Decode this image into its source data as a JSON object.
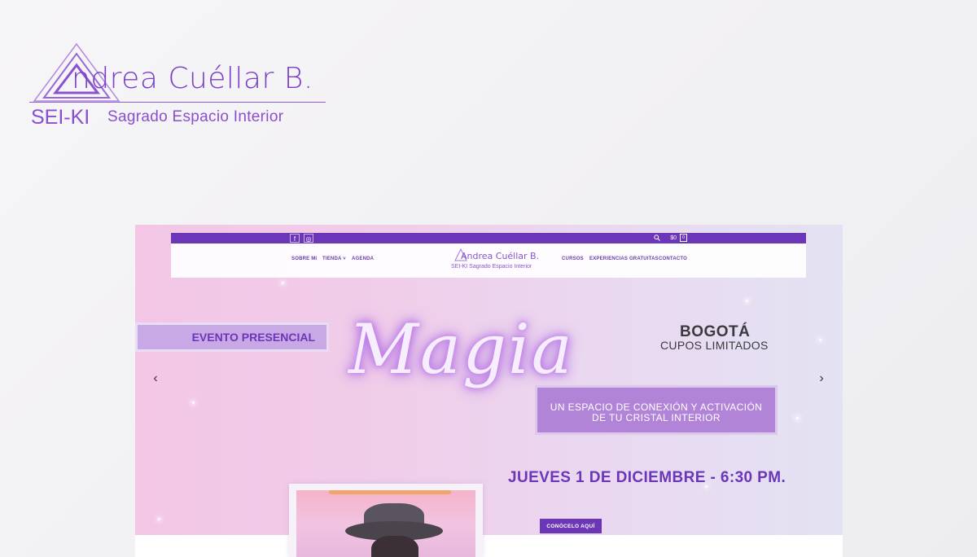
{
  "brand": {
    "name": "ndrea Cuéllar B.",
    "initial_glyph": "A",
    "sub_short": "SEI-KI",
    "sub_long": "Sagrado Espacio Interior"
  },
  "site": {
    "topbar": {
      "social": [
        {
          "icon": "facebook-icon",
          "glyph": "f"
        },
        {
          "icon": "instagram-icon",
          "glyph": "◎"
        }
      ],
      "cart_total": "$0",
      "cart_count": "0"
    },
    "nav": {
      "left": [
        "SOBRE MI",
        "TIENDA",
        "AGENDA"
      ],
      "right": [
        "CURSOS",
        "EXPERIENCIAS GRATUITAS",
        "CONTACTO"
      ],
      "logo_name": "Andrea Cuéllar B.",
      "logo_sub": "SEI-KI Sagrado Espacio Interior"
    },
    "hero": {
      "tag": "EVENTO PRESENCIAL",
      "title": "Magia",
      "city": "BOGOTÁ",
      "cupos": "CUPOS LIMITADOS",
      "box_line1": "UN ESPACIO DE CONEXIÓN  Y ACTIVACIÓN",
      "box_line2": "DE TU CRISTAL INTERIOR",
      "date": "JUEVES 1 DE DICIEMBRE - 6:30 PM.",
      "cta": "CONÓCELO AQUÍ",
      "prev": "‹",
      "next": "›"
    }
  },
  "colors": {
    "accent": "#6b36b8",
    "logo": "#7a3fc7",
    "box": "#b184d8"
  }
}
